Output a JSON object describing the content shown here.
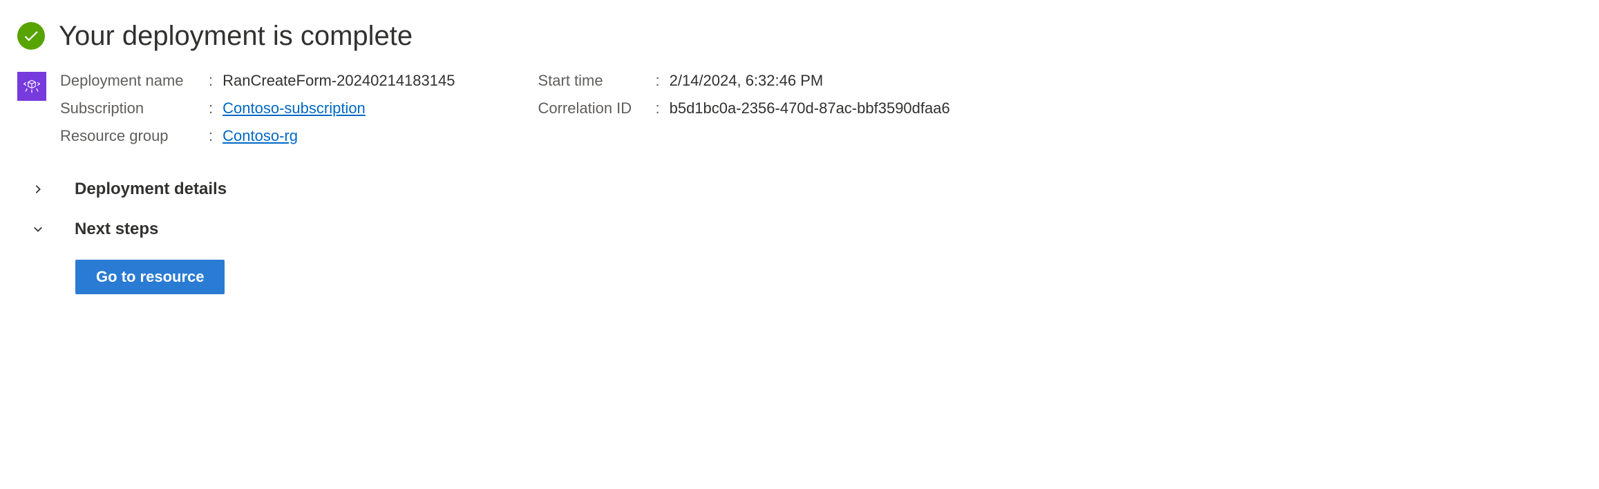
{
  "header": {
    "title": "Your deployment is complete"
  },
  "details": {
    "left": {
      "deployment_name_label": "Deployment name",
      "deployment_name_value": "RanCreateForm-20240214183145",
      "subscription_label": "Subscription",
      "subscription_value": "Contoso-subscription",
      "resource_group_label": "Resource group",
      "resource_group_value": "Contoso-rg"
    },
    "right": {
      "start_time_label": "Start time",
      "start_time_value": "2/14/2024, 6:32:46 PM",
      "correlation_id_label": "Correlation ID",
      "correlation_id_value": "b5d1bc0a-2356-470d-87ac-bbf3590dfaa6"
    }
  },
  "sections": {
    "deployment_details": "Deployment details",
    "next_steps": "Next steps"
  },
  "buttons": {
    "go_to_resource": "Go to resource"
  },
  "colors": {
    "success": "#57a300",
    "link": "#0068c4",
    "primary_button": "#2a7bd3",
    "resource_icon_bg": "#773adc"
  }
}
